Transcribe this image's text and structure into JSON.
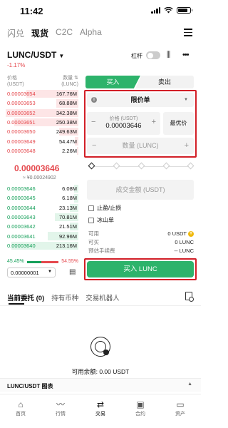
{
  "status": {
    "time": "11:42"
  },
  "top_nav": {
    "items": [
      "闪兑",
      "现货",
      "C2C",
      "Alpha"
    ],
    "active_index": 1
  },
  "pair": {
    "symbol": "LUNC/USDT",
    "change": "-1.17%",
    "leverage_label": "杠杆",
    "leverage_enabled": false
  },
  "orderbook": {
    "price_header": "价格\n(USDT)",
    "qty_header": "数量 ⇅\n(LUNC)",
    "price_header_l1": "价格",
    "price_header_l2": "(USDT)",
    "qty_header_l1": "数量 ⇅",
    "qty_header_l2": "(LUNC)",
    "asks": [
      {
        "price": "0.00003654",
        "qty": "167.76M",
        "depth": 0.72
      },
      {
        "price": "0.00003653",
        "qty": "68.88M",
        "depth": 0.3
      },
      {
        "price": "0.00003652",
        "qty": "342.38M",
        "depth": 1.0
      },
      {
        "price": "0.00003651",
        "qty": "250.38M",
        "depth": 0.88
      },
      {
        "price": "0.00003650",
        "qty": "249.63M",
        "depth": 0.26
      },
      {
        "price": "0.00003649",
        "qty": "54.47M",
        "depth": 0.05
      },
      {
        "price": "0.00003648",
        "qty": "2.26M",
        "depth": 0.02
      }
    ],
    "mid_price": "0.00003646",
    "mid_fiat": "≈ ¥0.00024902",
    "bids": [
      {
        "price": "0.00003646",
        "qty": "6.08M",
        "depth": 0.06
      },
      {
        "price": "0.00003645",
        "qty": "6.18M",
        "depth": 0.06
      },
      {
        "price": "0.00003644",
        "qty": "23.13M",
        "depth": 0.12
      },
      {
        "price": "0.00003643",
        "qty": "70.81M",
        "depth": 0.32
      },
      {
        "price": "0.00003642",
        "qty": "21.51M",
        "depth": 0.12
      },
      {
        "price": "0.00003641",
        "qty": "92.96M",
        "depth": 0.42
      },
      {
        "price": "0.00003640",
        "qty": "213.16M",
        "depth": 0.92
      }
    ],
    "buy_ratio": "45.45%",
    "sell_ratio": "54.55%",
    "buy_ratio_value": 0.4545,
    "precision": "0.00000001"
  },
  "trade_form": {
    "tab_buy": "买入",
    "tab_sell": "卖出",
    "order_type": "限价单",
    "price_label": "价格 (USDT)",
    "price_value": "0.00003646",
    "best_price_button": "最优价",
    "amount_placeholder": "数量 (LUNC)",
    "total_placeholder": "成交金额 (USDT)",
    "tp_sl_label": "止盈/止损",
    "iceberg_label": "冰山单",
    "available_label": "可用",
    "available_value": "0 USDT",
    "can_buy_label": "可买",
    "can_buy_value": "0 LUNC",
    "fee_label": "预估手续费",
    "fee_value": "-- LUNC",
    "buy_button": "买入 LUNC"
  },
  "lower_tabs": {
    "items": [
      "当前委托 (0)",
      "持有币种",
      "交易机器人"
    ],
    "active_index": 0
  },
  "empty_state": {
    "text": "可用余额: 0.00 USDT"
  },
  "chart_bar": {
    "label": "LUNC/USDT 图表"
  },
  "bottom_nav": {
    "items": [
      "首页",
      "行情",
      "交易",
      "合约",
      "资产"
    ],
    "active_index": 2
  },
  "colors": {
    "green": "#2db36b",
    "red": "#e5484d",
    "highlight": "#d21f27"
  }
}
